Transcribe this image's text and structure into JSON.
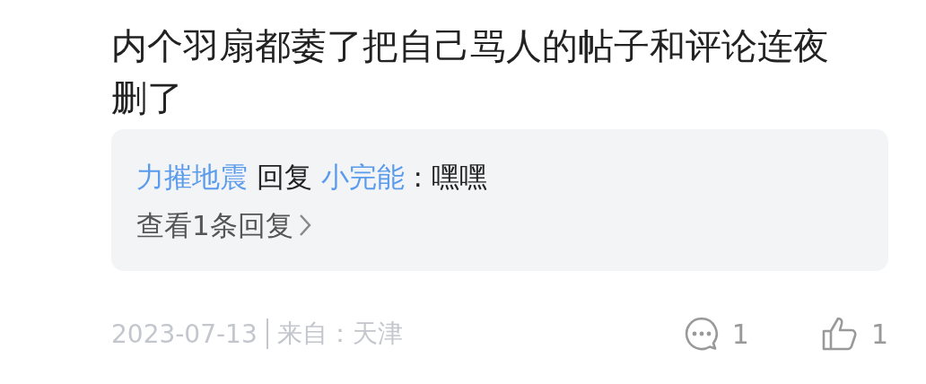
{
  "comment": {
    "text": "内个羽扇都萎了把自己骂人的帖子和评论连夜删了"
  },
  "replies": [
    {
      "author": "力摧地震",
      "verb": "回复",
      "target": "小完能",
      "separator": ":",
      "text": "嘿嘿"
    }
  ],
  "view_replies": "查看1条回复",
  "footer": {
    "date": "2023-07-13",
    "location": "来自：天津",
    "comment_count": "1",
    "like_count": "1"
  }
}
